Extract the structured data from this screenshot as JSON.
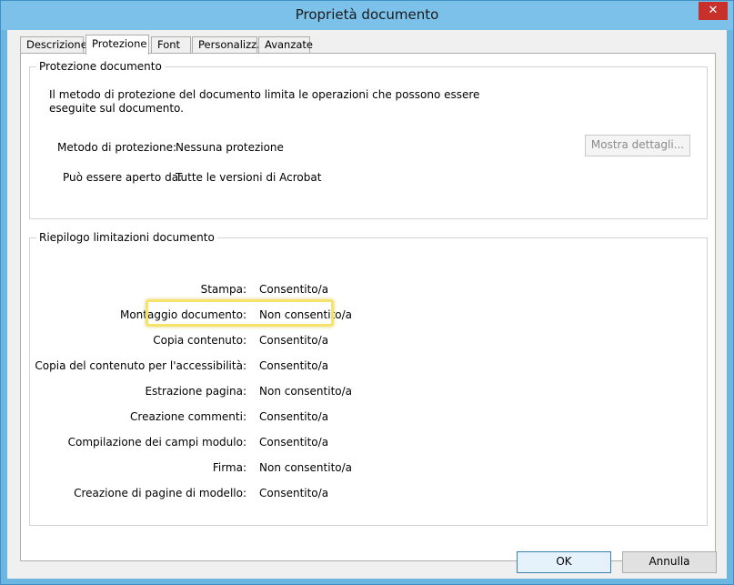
{
  "window": {
    "title": "Proprietà documento",
    "close_glyph": "✕"
  },
  "tabs": [
    {
      "label": "Descrizione",
      "active": false
    },
    {
      "label": "Protezione",
      "active": true
    },
    {
      "label": "Font",
      "active": false
    },
    {
      "label": "Personalizz.",
      "active": false
    },
    {
      "label": "Avanzate",
      "active": false
    }
  ],
  "protection": {
    "group_title": "Protezione documento",
    "description": "Il metodo di protezione del documento limita le operazioni che possono essere eseguite sul documento.",
    "method_label": "Metodo di protezione:",
    "method_value": "Nessuna protezione",
    "open_label": "Può essere aperto da:",
    "open_value": "Tutte le versioni di Acrobat",
    "details_button": "Mostra dettagli..."
  },
  "restrictions": {
    "group_title": "Riepilogo limitazioni documento",
    "rows": [
      {
        "label": "Stampa:",
        "value": "Consentito/a"
      },
      {
        "label": "Montaggio documento:",
        "value": "Non consentito/a"
      },
      {
        "label": "Copia contenuto:",
        "value": "Consentito/a"
      },
      {
        "label": "Copia del contenuto per l'accessibilità:",
        "value": "Consentito/a"
      },
      {
        "label": "Estrazione pagina:",
        "value": "Non consentito/a"
      },
      {
        "label": "Creazione commenti:",
        "value": "Consentito/a"
      },
      {
        "label": "Compilazione dei campi modulo:",
        "value": "Consentito/a"
      },
      {
        "label": "Firma:",
        "value": "Non consentito/a"
      },
      {
        "label": "Creazione di pagine di modello:",
        "value": "Consentito/a"
      }
    ],
    "highlighted_row": "Copia contenuto:"
  },
  "buttons": {
    "ok": "OK",
    "cancel": "Annulla"
  },
  "colors": {
    "highlight": "#f7e36a",
    "close_button": "#c7302b",
    "frame": "#6cb6e2"
  }
}
